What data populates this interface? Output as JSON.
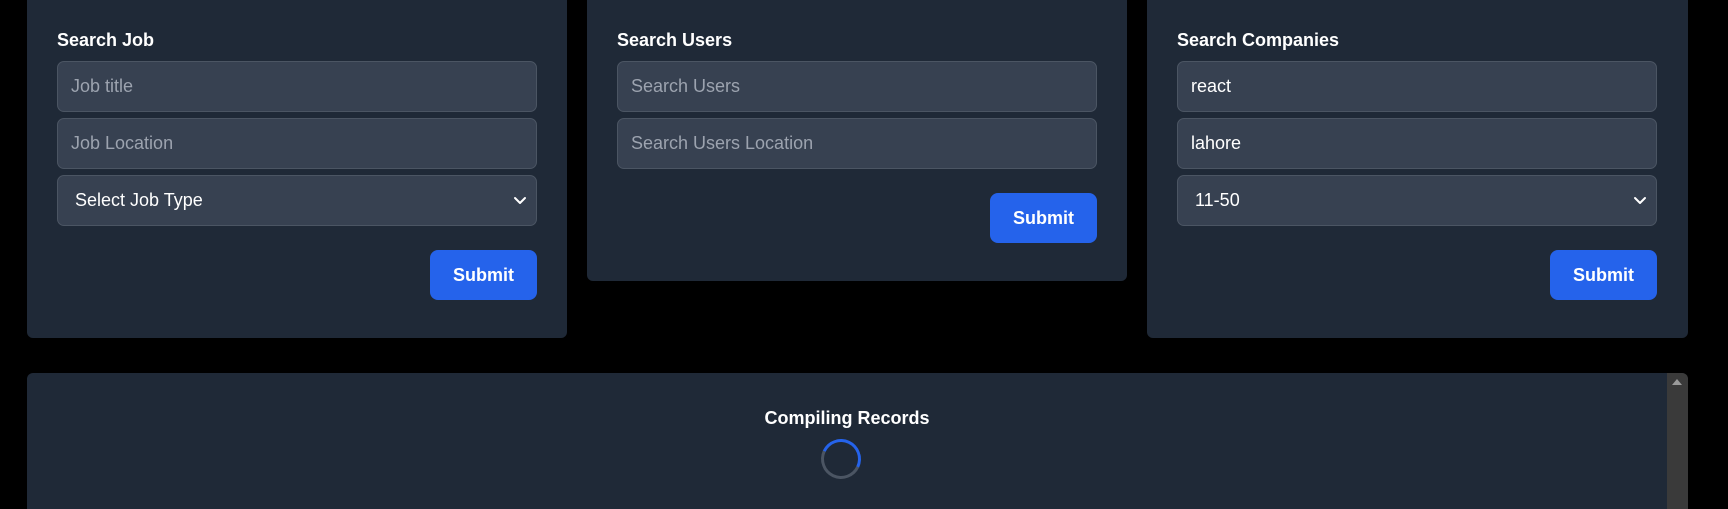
{
  "search_job": {
    "title": "Search Job",
    "title_placeholder": "Job title",
    "location_placeholder": "Job Location",
    "job_type_selected": "Select Job Type",
    "submit_label": "Submit"
  },
  "search_users": {
    "title": "Search Users",
    "query_placeholder": "Search Users",
    "location_placeholder": "Search Users Location",
    "submit_label": "Submit"
  },
  "search_companies": {
    "title": "Search Companies",
    "query_value": "react",
    "location_value": "lahore",
    "size_selected": "11-50",
    "submit_label": "Submit"
  },
  "results": {
    "status_text": "Compiling Records"
  },
  "colors": {
    "page_background": "#000000",
    "card_background": "#1f2937",
    "input_background": "#374151",
    "accent": "#2563eb"
  },
  "icons": {
    "select_arrow": "chevron-down-icon",
    "loader": "spinner-icon",
    "scroll_up": "scroll-up-arrow-icon"
  }
}
